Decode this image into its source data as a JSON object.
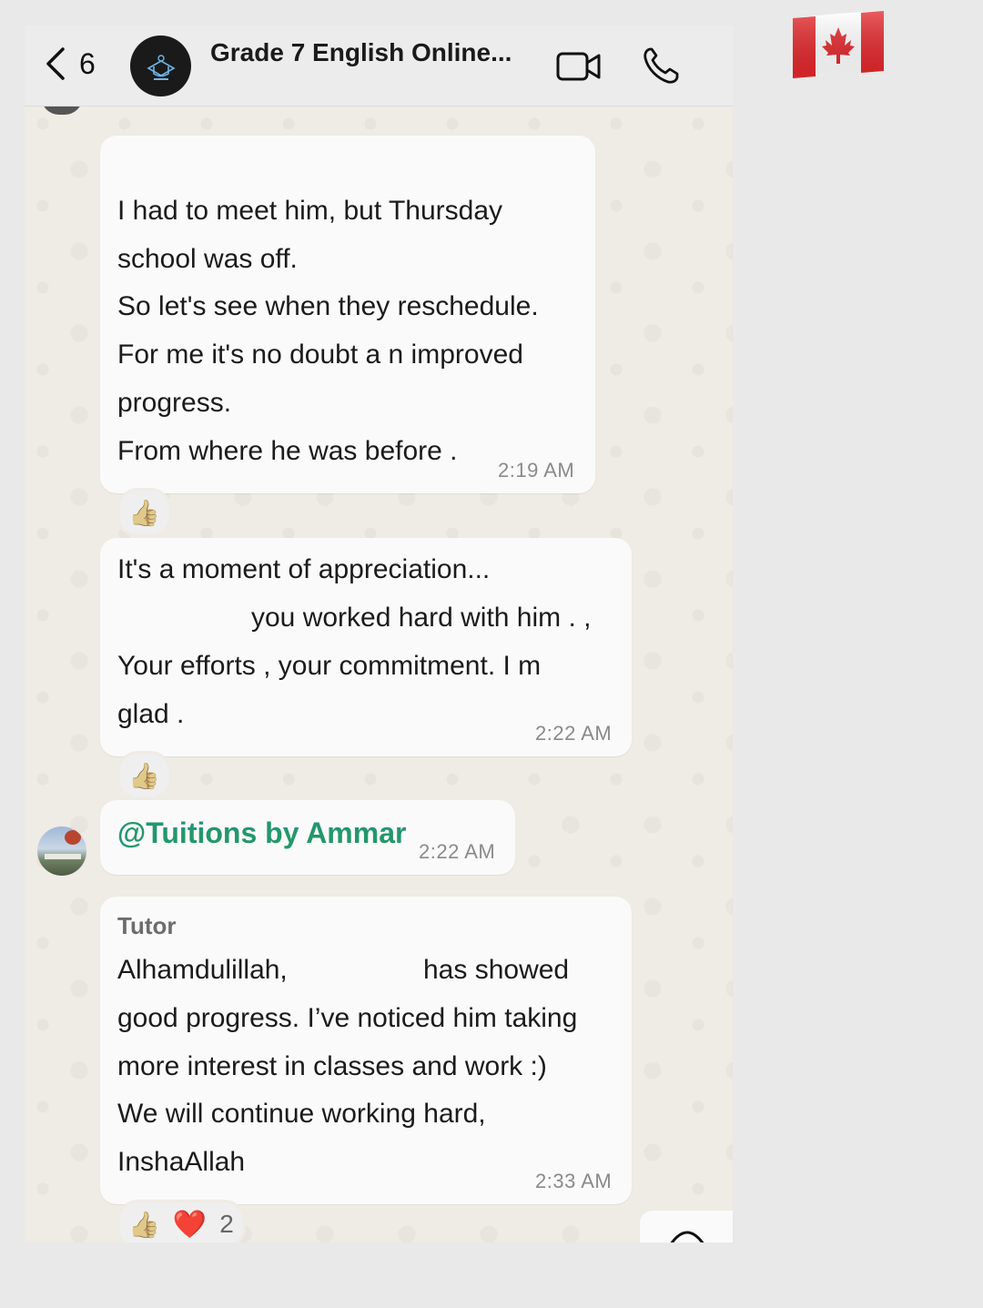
{
  "header": {
    "back_count": "6",
    "title": "Grade 7 English Online...",
    "icons": {
      "back": "chevron-left-icon",
      "video": "video-camera-icon",
      "call": "phone-icon"
    }
  },
  "messages": [
    {
      "lines": [
        "I had to meet him, but Thursday",
        "school  was  off.",
        "So let's see when they reschedule.",
        "For me it's  no doubt a n improved",
        "progress.",
        "From where he was before ."
      ],
      "time": "2:19 AM",
      "reaction": "👍"
    },
    {
      "lines": [
        "It's a moment  of appreciation...",
        "you worked hard with him . ,",
        "Your efforts , your commitment. I m",
        "glad ."
      ],
      "time": "2:22 AM",
      "reaction": "👍"
    },
    {
      "mention": "@Tuitions by Ammar",
      "time": "2:22 AM"
    },
    {
      "sender": "Tutor",
      "lines": [
        "Alhamdulillah,",
        "has showed",
        "good progress. I’ve noticed him taking",
        "more interest in classes and work :)",
        "We will continue working hard,",
        "InshaAllah"
      ],
      "time": "2:33 AM",
      "reactions": [
        "👍",
        "❤️"
      ],
      "reaction_count": "2"
    }
  ],
  "colors": {
    "mention": "#23976d",
    "bubble": "#fafafa",
    "chat_background": "#efebe5"
  }
}
